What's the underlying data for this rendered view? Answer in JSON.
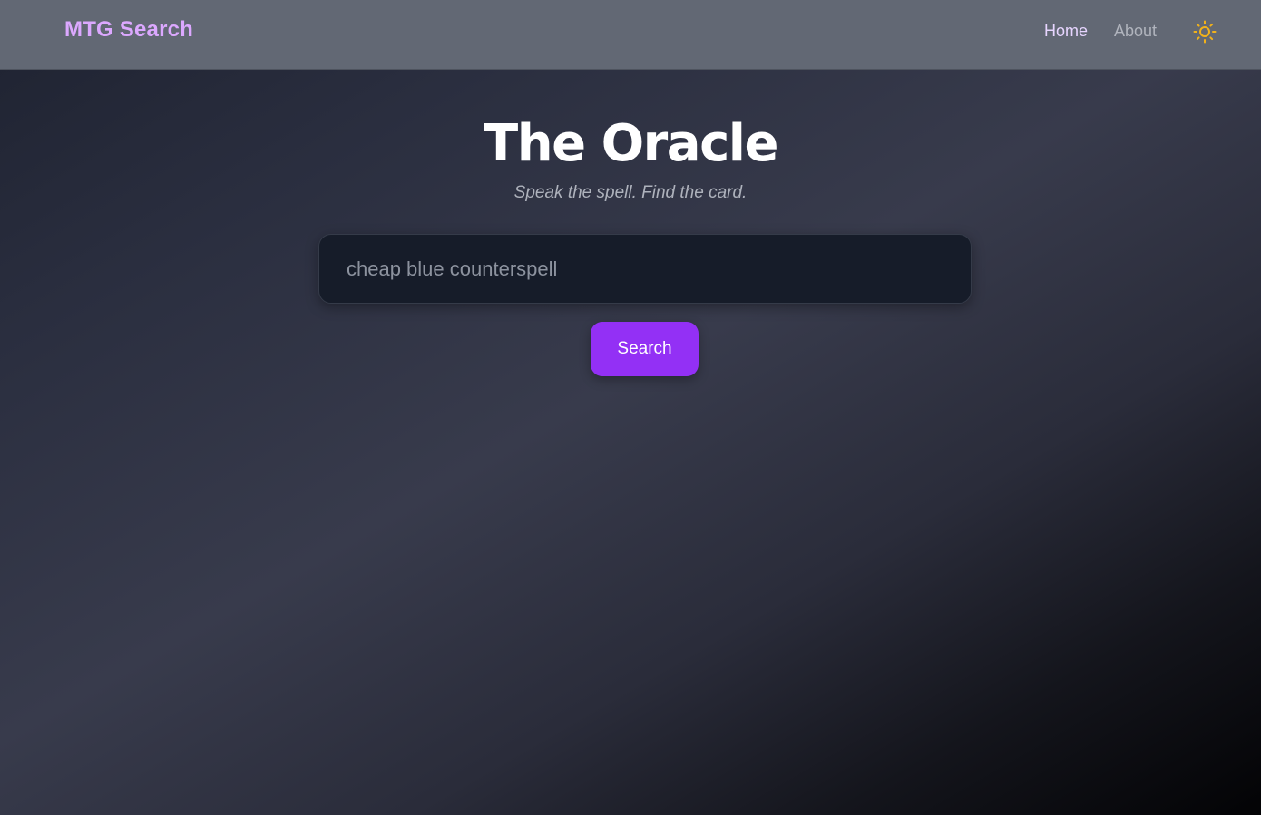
{
  "navbar": {
    "brand": "MTG Search",
    "links": [
      {
        "label": "Home",
        "active": true
      },
      {
        "label": "About",
        "active": false
      }
    ],
    "theme_toggle_icon": "sun-icon"
  },
  "hero": {
    "title": "The Oracle",
    "subtitle": "Speak the spell. Find the card."
  },
  "search": {
    "placeholder": "cheap blue counterspell",
    "value": "",
    "button_label": "Search"
  },
  "colors": {
    "brand": "#dca8ff",
    "accent": "#9330f5",
    "sun": "#f2b21a",
    "navbar_bg": "#626874"
  }
}
